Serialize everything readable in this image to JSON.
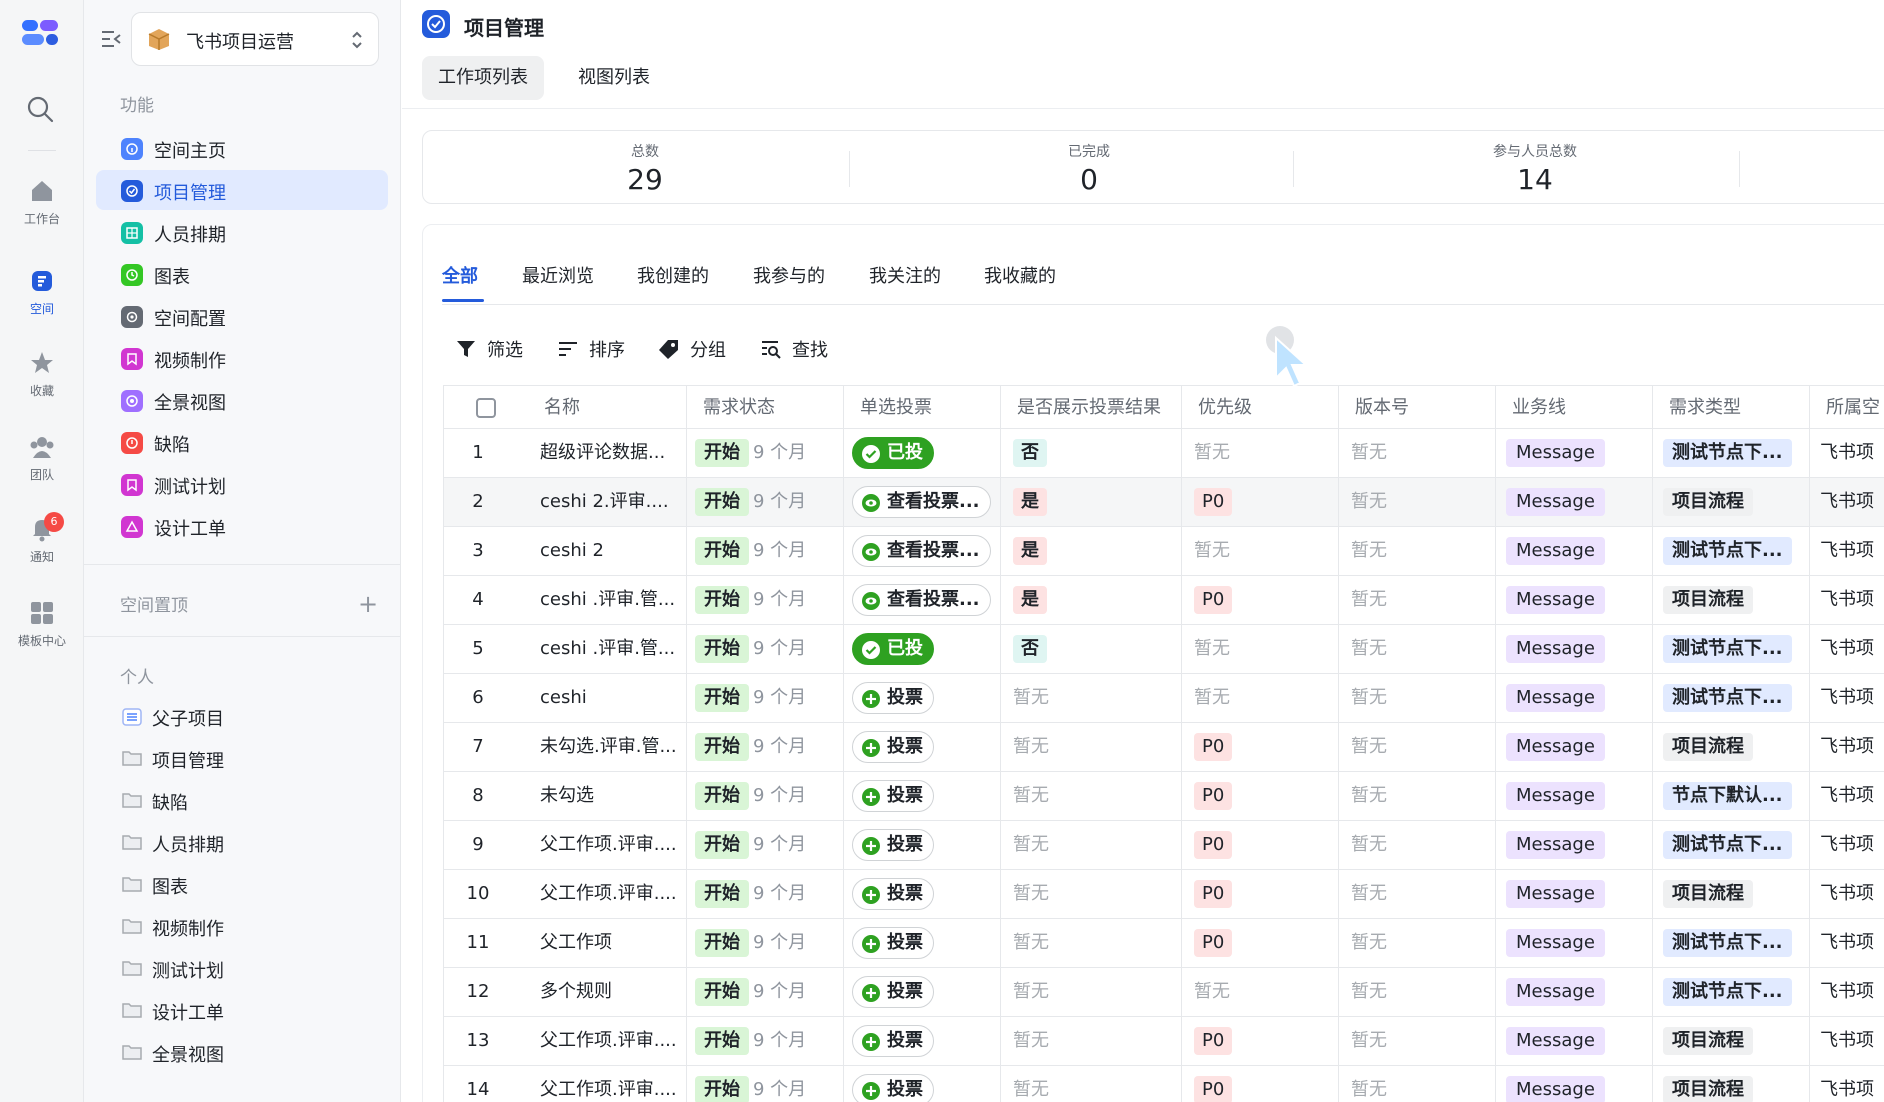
{
  "rail": {
    "items": [
      {
        "label": "工作台"
      },
      {
        "label": "空间"
      },
      {
        "label": "收藏"
      },
      {
        "label": "团队"
      },
      {
        "label": "通知",
        "badge": "6"
      },
      {
        "label": "模板中心"
      }
    ]
  },
  "sidebar": {
    "space_name": "飞书项目运营",
    "section_features": "功能",
    "features": [
      {
        "label": "空间主页",
        "icon": "info-icon",
        "color": "#4e83fd"
      },
      {
        "label": "项目管理",
        "icon": "check-icon",
        "color": "#245bdb",
        "active": true
      },
      {
        "label": "人员排期",
        "icon": "table-icon",
        "color": "#14c0a5"
      },
      {
        "label": "图表",
        "icon": "clock-icon",
        "color": "#34c724"
      },
      {
        "label": "空间配置",
        "icon": "gear-icon",
        "color": "#646a73"
      },
      {
        "label": "视频制作",
        "icon": "bookmark-icon",
        "color": "#d136d1"
      },
      {
        "label": "全景视图",
        "icon": "panorama-icon",
        "color": "#9f6fff"
      },
      {
        "label": "缺陷",
        "icon": "alert-icon",
        "color": "#f54a45"
      },
      {
        "label": "测试计划",
        "icon": "bookmark-icon",
        "color": "#d136d1"
      },
      {
        "label": "设计工单",
        "icon": "ticket-icon",
        "color": "#d136d1"
      }
    ],
    "section_pinned": "空间置顶",
    "section_personal": "个人",
    "personal": [
      {
        "label": "父子项目",
        "icon": "list-icon"
      },
      {
        "label": "项目管理",
        "icon": "folder-icon"
      },
      {
        "label": "缺陷",
        "icon": "folder-icon"
      },
      {
        "label": "人员排期",
        "icon": "folder-icon"
      },
      {
        "label": "图表",
        "icon": "folder-icon"
      },
      {
        "label": "视频制作",
        "icon": "folder-icon"
      },
      {
        "label": "测试计划",
        "icon": "folder-icon"
      },
      {
        "label": "设计工单",
        "icon": "folder-icon"
      },
      {
        "label": "全景视图",
        "icon": "folder-icon"
      }
    ]
  },
  "header": {
    "title": "项目管理",
    "tabs": [
      {
        "label": "工作项列表",
        "active": true
      },
      {
        "label": "视图列表"
      }
    ]
  },
  "stats": [
    {
      "label": "总数",
      "value": "29"
    },
    {
      "label": "已完成",
      "value": "0"
    },
    {
      "label": "参与人员总数",
      "value": "14"
    }
  ],
  "filter_tabs": [
    {
      "label": "全部",
      "active": true
    },
    {
      "label": "最近浏览"
    },
    {
      "label": "我创建的"
    },
    {
      "label": "我参与的"
    },
    {
      "label": "我关注的"
    },
    {
      "label": "我收藏的"
    }
  ],
  "toolbar": {
    "filter": "筛选",
    "sort": "排序",
    "group": "分组",
    "find": "查找"
  },
  "table": {
    "columns": [
      "名称",
      "需求状态",
      "单选投票",
      "是否展示投票结果",
      "优先级",
      "版本号",
      "业务线",
      "需求类型",
      "所属空"
    ],
    "rows": [
      {
        "idx": "1",
        "name": "超级评论数据...",
        "status": "开始",
        "ago": "9 个月",
        "vote": "已投",
        "vote_type": "done",
        "show": "否",
        "show_type": "no",
        "priority": "暂无",
        "version": "暂无",
        "biz": "Message",
        "rtype": "测试节点下...",
        "rtype_kind": "t-test",
        "owner": "飞书项"
      },
      {
        "idx": "2",
        "name": "ceshi 2.评审....",
        "status": "开始",
        "ago": "9 个月",
        "vote": "查看投票...",
        "vote_type": "view",
        "show": "是",
        "show_type": "yes",
        "priority": "P0",
        "version": "暂无",
        "biz": "Message",
        "rtype": "项目流程",
        "rtype_kind": "t-flow",
        "owner": "飞书项",
        "hover": true
      },
      {
        "idx": "3",
        "name": "ceshi 2",
        "status": "开始",
        "ago": "9 个月",
        "vote": "查看投票...",
        "vote_type": "view",
        "show": "是",
        "show_type": "yes",
        "priority": "暂无",
        "version": "暂无",
        "biz": "Message",
        "rtype": "测试节点下...",
        "rtype_kind": "t-test",
        "owner": "飞书项"
      },
      {
        "idx": "4",
        "name": "ceshi .评审.管...",
        "status": "开始",
        "ago": "9 个月",
        "vote": "查看投票...",
        "vote_type": "view",
        "show": "是",
        "show_type": "yes",
        "priority": "P0",
        "version": "暂无",
        "biz": "Message",
        "rtype": "项目流程",
        "rtype_kind": "t-flow",
        "owner": "飞书项"
      },
      {
        "idx": "5",
        "name": "ceshi .评审.管...",
        "status": "开始",
        "ago": "9 个月",
        "vote": "已投",
        "vote_type": "done",
        "show": "否",
        "show_type": "no",
        "priority": "暂无",
        "version": "暂无",
        "biz": "Message",
        "rtype": "测试节点下...",
        "rtype_kind": "t-test",
        "owner": "飞书项"
      },
      {
        "idx": "6",
        "name": "ceshi",
        "status": "开始",
        "ago": "9 个月",
        "vote": "投票",
        "vote_type": "cast",
        "show": "暂无",
        "show_type": "na",
        "priority": "暂无",
        "version": "暂无",
        "biz": "Message",
        "rtype": "测试节点下...",
        "rtype_kind": "t-test",
        "owner": "飞书项"
      },
      {
        "idx": "7",
        "name": "未勾选.评审.管...",
        "status": "开始",
        "ago": "9 个月",
        "vote": "投票",
        "vote_type": "cast",
        "show": "暂无",
        "show_type": "na",
        "priority": "P0",
        "version": "暂无",
        "biz": "Message",
        "rtype": "项目流程",
        "rtype_kind": "t-flow",
        "owner": "飞书项"
      },
      {
        "idx": "8",
        "name": "未勾选",
        "status": "开始",
        "ago": "9 个月",
        "vote": "投票",
        "vote_type": "cast",
        "show": "暂无",
        "show_type": "na",
        "priority": "P0",
        "version": "暂无",
        "biz": "Message",
        "rtype": "节点下默认...",
        "rtype_kind": "t-node",
        "owner": "飞书项"
      },
      {
        "idx": "9",
        "name": "父工作项.评审....",
        "status": "开始",
        "ago": "9 个月",
        "vote": "投票",
        "vote_type": "cast",
        "show": "暂无",
        "show_type": "na",
        "priority": "P0",
        "version": "暂无",
        "biz": "Message",
        "rtype": "测试节点下...",
        "rtype_kind": "t-test",
        "owner": "飞书项"
      },
      {
        "idx": "10",
        "name": "父工作项.评审....",
        "status": "开始",
        "ago": "9 个月",
        "vote": "投票",
        "vote_type": "cast",
        "show": "暂无",
        "show_type": "na",
        "priority": "P0",
        "version": "暂无",
        "biz": "Message",
        "rtype": "项目流程",
        "rtype_kind": "t-flow",
        "owner": "飞书项"
      },
      {
        "idx": "11",
        "name": "父工作项",
        "status": "开始",
        "ago": "9 个月",
        "vote": "投票",
        "vote_type": "cast",
        "show": "暂无",
        "show_type": "na",
        "priority": "P0",
        "version": "暂无",
        "biz": "Message",
        "rtype": "测试节点下...",
        "rtype_kind": "t-test",
        "owner": "飞书项"
      },
      {
        "idx": "12",
        "name": "多个规则",
        "status": "开始",
        "ago": "9 个月",
        "vote": "投票",
        "vote_type": "cast",
        "show": "暂无",
        "show_type": "na",
        "priority": "暂无",
        "version": "暂无",
        "biz": "Message",
        "rtype": "测试节点下...",
        "rtype_kind": "t-test",
        "owner": "飞书项"
      },
      {
        "idx": "13",
        "name": "父工作项.评审....",
        "status": "开始",
        "ago": "9 个月",
        "vote": "投票",
        "vote_type": "cast",
        "show": "暂无",
        "show_type": "na",
        "priority": "P0",
        "version": "暂无",
        "biz": "Message",
        "rtype": "项目流程",
        "rtype_kind": "t-flow",
        "owner": "飞书项"
      },
      {
        "idx": "14",
        "name": "父工作项.评审....",
        "status": "开始",
        "ago": "9 个月",
        "vote": "投票",
        "vote_type": "cast",
        "show": "暂无",
        "show_type": "na",
        "priority": "P0",
        "version": "暂无",
        "biz": "Message",
        "rtype": "项目流程",
        "rtype_kind": "t-flow",
        "owner": "飞书项"
      }
    ]
  },
  "colors": {
    "accent": "#245bdb",
    "vote_done": "#2ea121",
    "status_tag": "#d9f5d6",
    "biz_tag": "#ece2fe"
  }
}
